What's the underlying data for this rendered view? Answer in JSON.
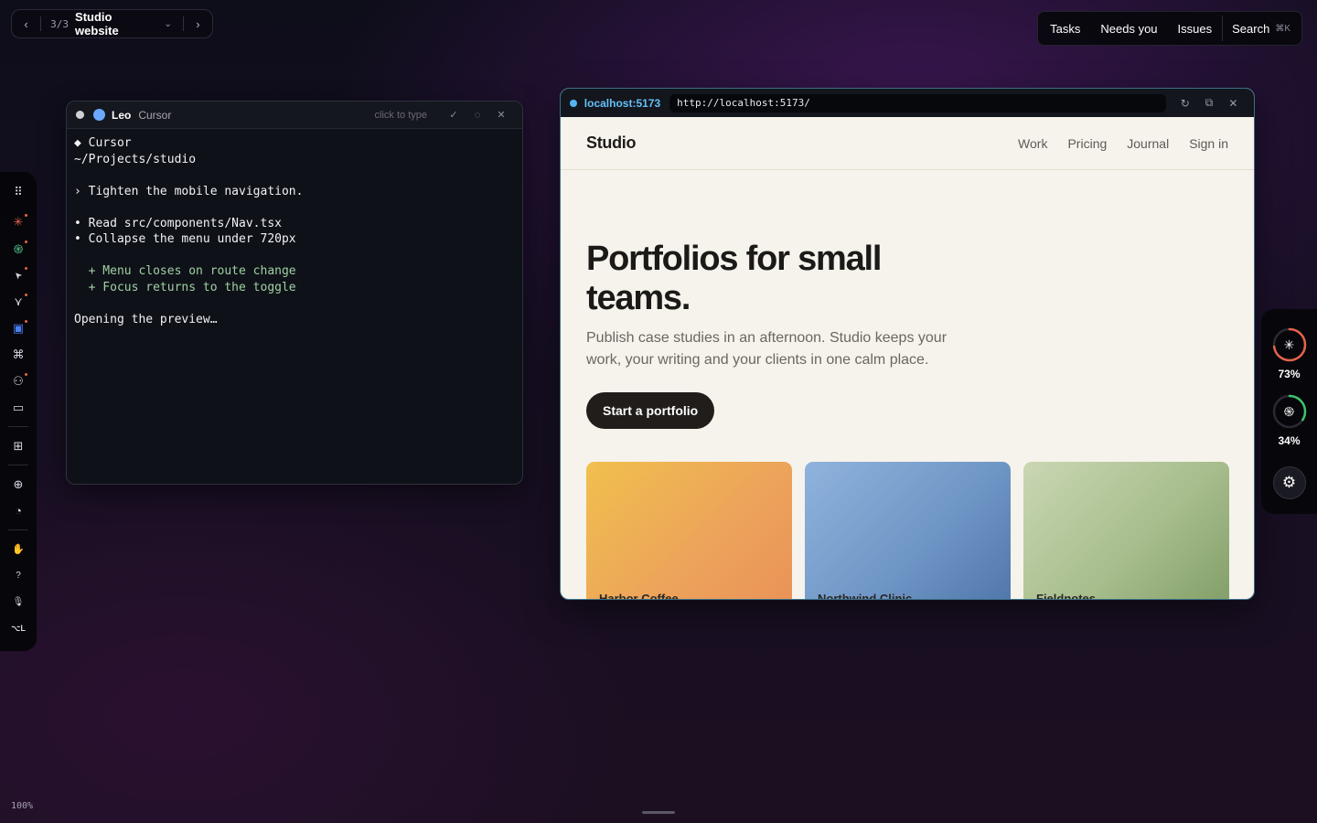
{
  "switcher": {
    "prev_icon": "chevron-left-icon",
    "count": "3/3",
    "title": "Studio website",
    "dropdown_icon": "chevron-down-icon",
    "next_icon": "chevron-right-icon"
  },
  "topnav": {
    "tasks": "Tasks",
    "needs_you": "Needs you",
    "issues": "Issues",
    "search": "Search",
    "search_shortcut": "⌘K"
  },
  "dock": {
    "items": [
      {
        "icon": "grip-icon",
        "glyph": "⠿"
      },
      {
        "icon": "claude-icon",
        "glyph": "✳",
        "color": "#e5634a"
      },
      {
        "icon": "openai-icon",
        "glyph": "֍",
        "color": "#55c08a"
      },
      {
        "icon": "cursor-pointer-icon",
        "glyph": "➤"
      },
      {
        "icon": "vercel-icon",
        "glyph": "⋎"
      },
      {
        "icon": "app-badge-icon",
        "glyph": "▣",
        "color": "#4a7ef0"
      },
      {
        "icon": "command-icon",
        "glyph": "⌘"
      },
      {
        "icon": "people-icon",
        "glyph": "⚇"
      },
      {
        "icon": "folder-icon",
        "glyph": "▭"
      },
      {
        "icon": "apps-grid-icon",
        "glyph": "⊞"
      },
      {
        "icon": "globe-grid-icon",
        "glyph": "⊕"
      },
      {
        "icon": "palette-icon",
        "glyph": "◔"
      },
      {
        "icon": "hand-icon",
        "glyph": "✋"
      },
      {
        "icon": "help-icon",
        "glyph": "?"
      },
      {
        "icon": "microphone-icon",
        "glyph": "🎙"
      },
      {
        "icon": "option-l-shortcut",
        "glyph": "⌥L"
      }
    ]
  },
  "terminal": {
    "agent_name": "Leo",
    "agent_tool": "Cursor",
    "hint": "click to type",
    "lines": [
      {
        "text": "◆ Cursor",
        "style": ""
      },
      {
        "text": "~/Projects/studio",
        "style": ""
      },
      {
        "text": "",
        "style": ""
      },
      {
        "text": "› Tighten the mobile navigation.",
        "style": ""
      },
      {
        "text": "",
        "style": ""
      },
      {
        "text": "• Read src/components/Nav.tsx",
        "style": ""
      },
      {
        "text": "• Collapse the menu under 720px",
        "style": ""
      },
      {
        "text": "",
        "style": ""
      },
      {
        "text": "  + Menu closes on route change",
        "style": "green"
      },
      {
        "text": "  + Focus returns to the toggle",
        "style": "green"
      },
      {
        "text": "",
        "style": ""
      },
      {
        "text": "Opening the preview…",
        "style": ""
      }
    ]
  },
  "browser": {
    "host": "localhost:5173",
    "url": "http://localhost:5173/",
    "site": {
      "logo": "Studio",
      "nav": [
        "Work",
        "Pricing",
        "Journal",
        "Sign in"
      ],
      "hero_title": "Portfolios for small teams.",
      "hero_subtitle": "Publish case studies in an afternoon. Studio keeps your work, your writing and your clients in one calm place.",
      "cta": "Start a portfolio",
      "cards": [
        "Harbor Coffee",
        "Northwind Clinic",
        "Fieldnotes"
      ]
    }
  },
  "rail": {
    "usage": [
      {
        "icon": "claude-icon",
        "percent": 0.73,
        "label": "73%",
        "color": "#e5634a"
      },
      {
        "icon": "openai-icon",
        "percent": 0.34,
        "label": "34%",
        "color": "#3ec46d"
      }
    ],
    "settings_icon": "gear-icon"
  },
  "zoom_level": "100%",
  "accent_colors": {
    "host": "#62c0f7",
    "live_dot": "#53b6f3",
    "badge_dot": "#e5634a"
  }
}
